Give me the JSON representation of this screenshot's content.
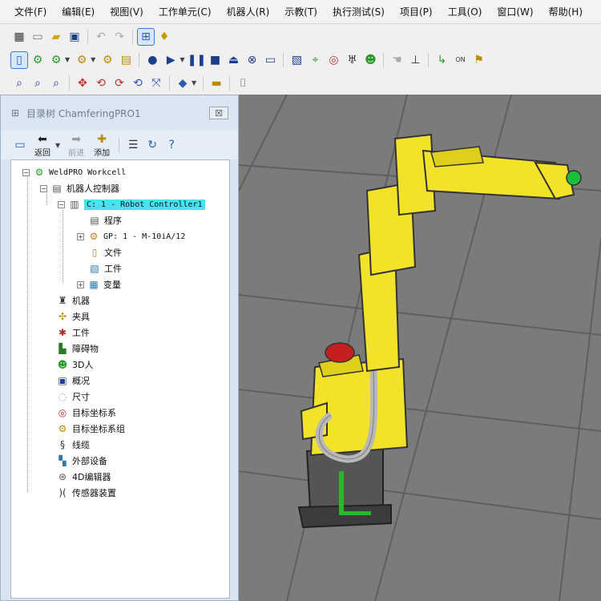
{
  "menu": [
    "文件(F)",
    "编辑(E)",
    "视图(V)",
    "工作单元(C)",
    "机器人(R)",
    "示教(T)",
    "执行测试(S)",
    "项目(P)",
    "工具(O)",
    "窗口(W)",
    "帮助(H)"
  ],
  "panel": {
    "title": "目录树 ChamferingPRO1",
    "close_label": "☒",
    "toolbar": {
      "back": "返回",
      "forward": "前进",
      "add": "添加"
    }
  },
  "tree": {
    "root": "WeldPRO Workcell",
    "robot_controllers": "机器人控制器",
    "controller": "C: 1 - Robot Controller1",
    "program": "程序",
    "gp": "GP: 1 - M-10iA/12",
    "file": "文件",
    "work": "工件",
    "variables": "变量",
    "machines": "机器",
    "fixtures": "夹具",
    "parts": "工件",
    "obstacles": "障碍物",
    "humans": "3D人",
    "overview": "概况",
    "measure": "尺寸",
    "target_frames": "目标坐标系",
    "target_frame_groups": "目标坐标系组",
    "cables": "线缆",
    "external_devices": "外部设备",
    "encoders": "4D编辑器",
    "sensors": "传感器装置"
  },
  "colors": {
    "robot_yellow": "#f2e22a",
    "scene_gray": "#7b7b7b",
    "highlight": "#47e3f0"
  }
}
